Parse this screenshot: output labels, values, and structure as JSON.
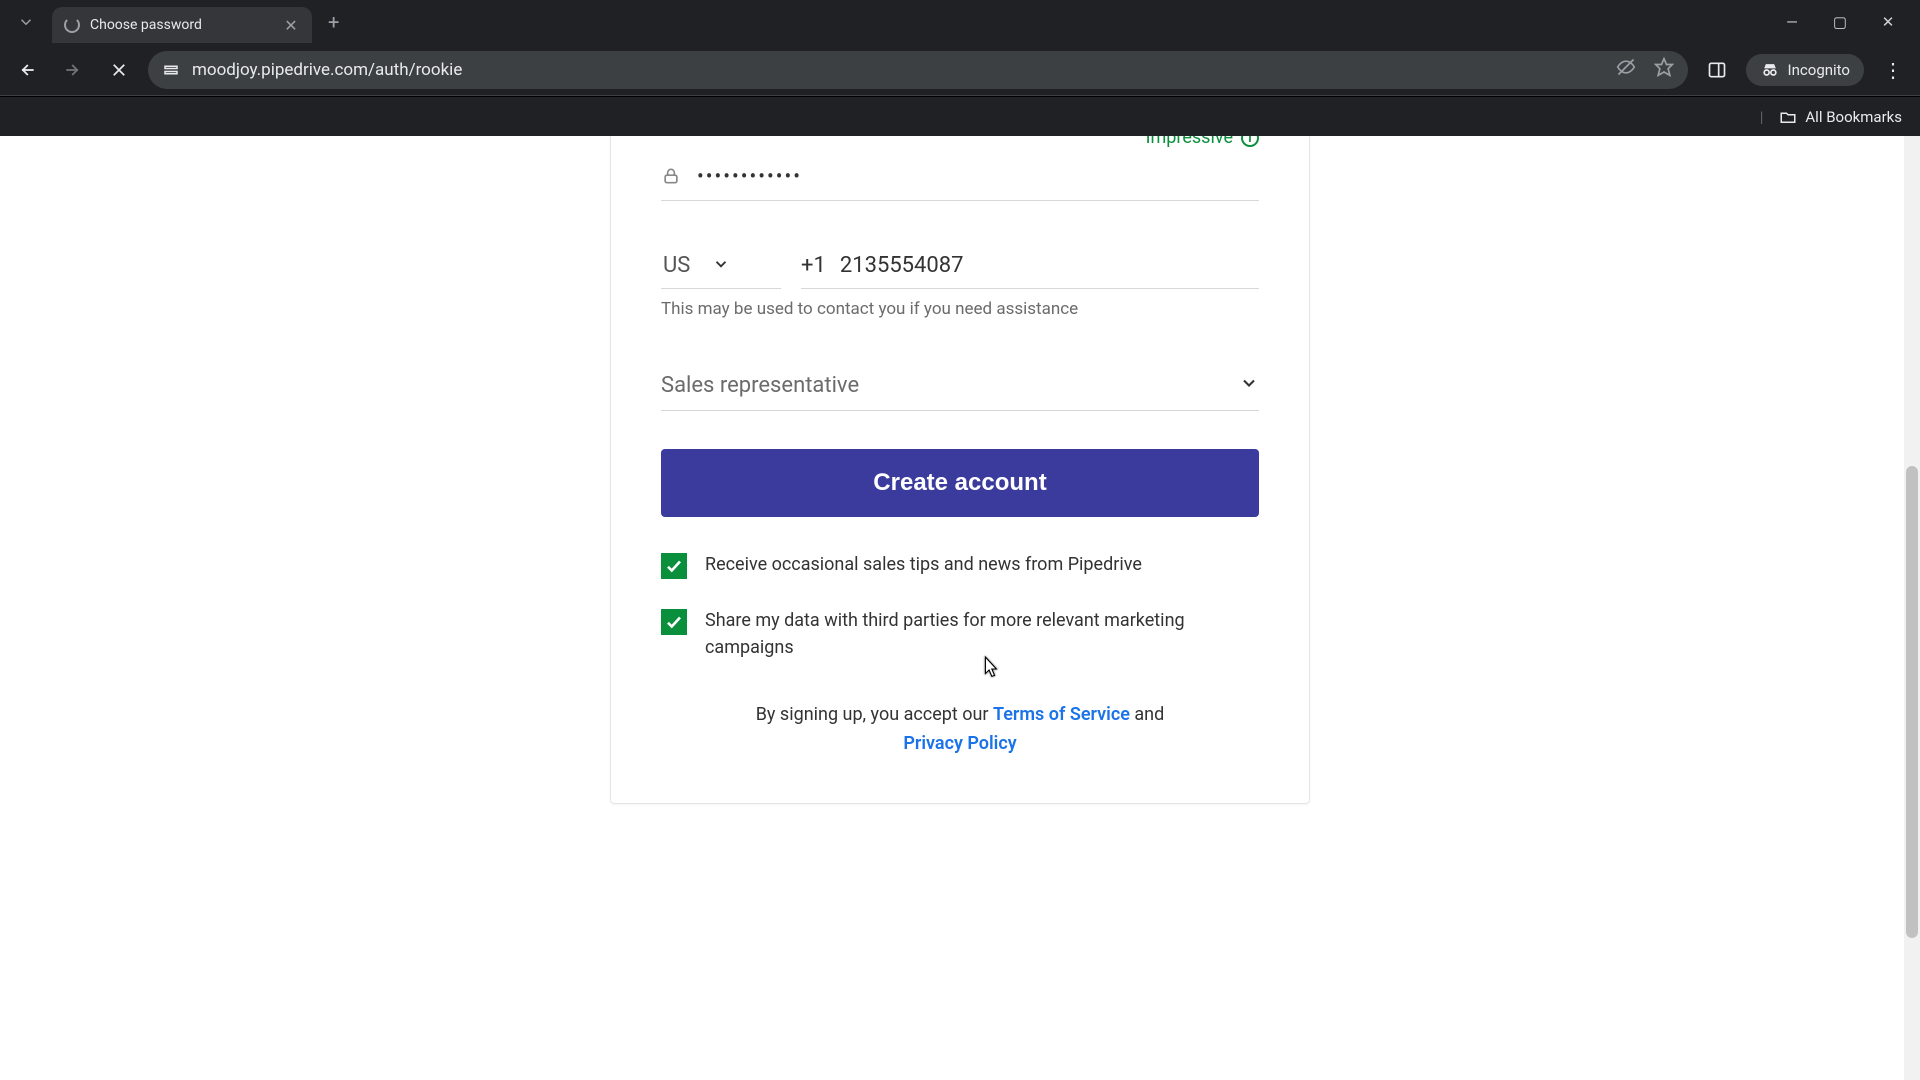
{
  "browser": {
    "tab_title": "Choose password",
    "url": "moodjoy.pipedrive.com/auth/rookie",
    "incognito_label": "Incognito",
    "all_bookmarks": "All Bookmarks"
  },
  "form": {
    "password_strength": "Impressive",
    "password_value": "••••••••••••",
    "country_code": "US",
    "phone_prefix": "+1",
    "phone_number": "2135554087",
    "phone_hint": "This may be used to contact you if you need assistance",
    "role": "Sales representative",
    "submit_label": "Create account",
    "checkbox1_label": "Receive occasional sales tips and news from Pipedrive",
    "checkbox2_label": "Share my data with third parties for more relevant marketing campaigns",
    "legal_prefix": "By signing up, you accept our ",
    "tos_label": "Terms of Service",
    "legal_and": " and ",
    "privacy_label": "Privacy Policy"
  }
}
